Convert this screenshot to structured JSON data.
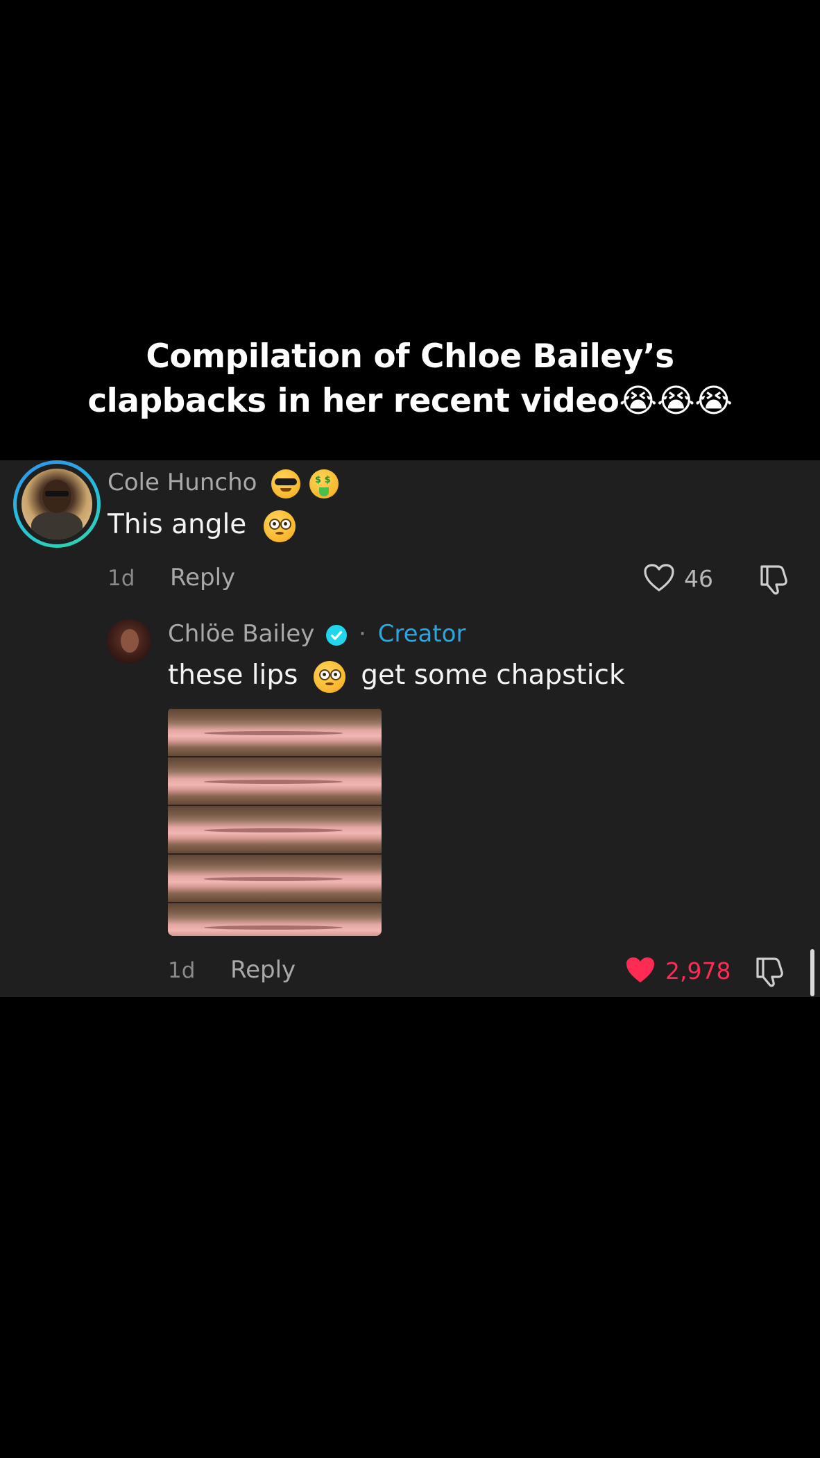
{
  "caption": {
    "line1": "Compilation of Chloe Bailey’s",
    "line2": "clapbacks in her recent video😭😭😭"
  },
  "comment": {
    "username": "Cole Huncho",
    "username_emojis": [
      "smiling-face-with-sunglasses",
      "money-mouth-face"
    ],
    "text": "This angle",
    "text_emoji": "flushed-face",
    "time": "1d",
    "reply_label": "Reply",
    "like_count": "46",
    "liked": false
  },
  "reply": {
    "username": "Chlöe Bailey",
    "verified": true,
    "separator": "·",
    "badge": "Creator",
    "text_before": "these lips",
    "text_emoji": "flushed-face",
    "text_after": "get some chapstick",
    "attachment": "lips-gif",
    "time": "1d",
    "reply_label": "Reply",
    "like_count": "2,978",
    "liked": true
  },
  "colors": {
    "background": "#000000",
    "panel": "#1f1f1f",
    "like_active": "#fe2c55",
    "creator_badge": "#2aa7e0",
    "verified_badge": "#20d5ec"
  }
}
